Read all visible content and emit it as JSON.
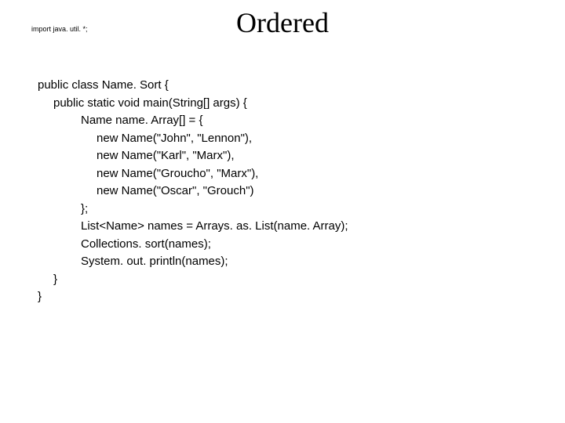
{
  "title": "Ordered",
  "import_line": "import java. util. *;",
  "code": {
    "l1": "public class Name. Sort {",
    "l2": "public static void main(String[] args) {",
    "l3": "Name name. Array[] = {",
    "l4": "new Name(\"John\", \"Lennon\"),",
    "l5": "new Name(\"Karl\", \"Marx\"),",
    "l6": "new Name(\"Groucho\", \"Marx\"),",
    "l7": "new Name(\"Oscar\", \"Grouch\")",
    "l8": "};",
    "l9": "List<Name> names = Arrays. as. List(name. Array);",
    "l10": "Collections. sort(names);",
    "l11": "System. out. println(names);",
    "l12": "}",
    "l13": "}"
  }
}
